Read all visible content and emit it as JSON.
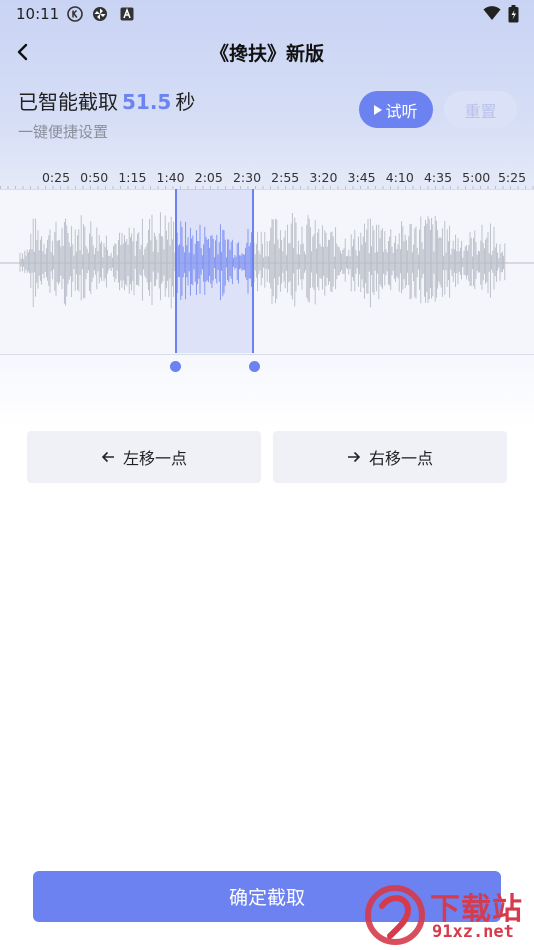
{
  "status_bar": {
    "time": "10:11",
    "icons": [
      "k-icon",
      "pinwheel-icon",
      "a-icon"
    ],
    "right_icons": [
      "wifi-icon",
      "battery-icon"
    ]
  },
  "header": {
    "back_icon": "chevron-left-icon",
    "title": "《搀扶》新版"
  },
  "clip_info": {
    "prefix": "已智能截取",
    "duration": "51.5",
    "unit": "秒",
    "subtitle": "一键便捷设置"
  },
  "actions": {
    "play_label": "试听",
    "reset_label": "重置"
  },
  "timeline": {
    "ticks": [
      "0:25",
      "0:50",
      "1:15",
      "1:40",
      "2:05",
      "2:30",
      "2:55",
      "3:20",
      "3:45",
      "4:10",
      "4:35",
      "5:00",
      "5:25"
    ]
  },
  "nudge": {
    "left_label": "左移一点",
    "right_label": "右移一点"
  },
  "confirm_label": "确定截取",
  "watermark": {
    "line1": "下载站",
    "line2": "91xz.net"
  },
  "colors": {
    "accent": "#6c82f0",
    "wave": "#b7bcc6",
    "wave_selected": "#7d92f2"
  }
}
